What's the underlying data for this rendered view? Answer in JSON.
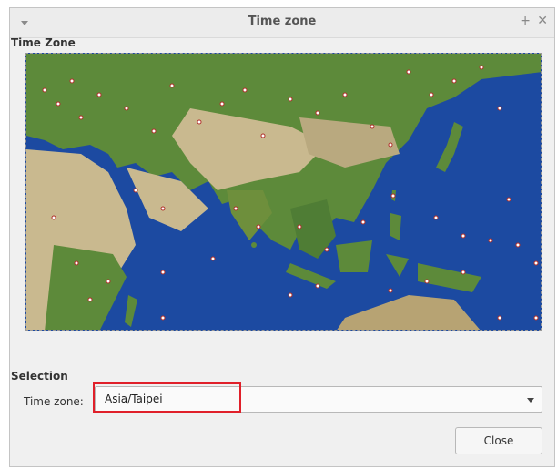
{
  "window": {
    "title": "Time zone",
    "maximize_symbol": "+",
    "close_symbol": "✕"
  },
  "timezone_section": {
    "label": "Time Zone"
  },
  "selection_section": {
    "label": "Selection",
    "field_label": "Time zone:",
    "value": "Asia/Taipei"
  },
  "buttons": {
    "close_label": "Close"
  },
  "colors": {
    "ocean": "#1c4aa1",
    "land": "#5d8a3a",
    "desert": "#c9b98f",
    "highlight": "#e0202a"
  }
}
